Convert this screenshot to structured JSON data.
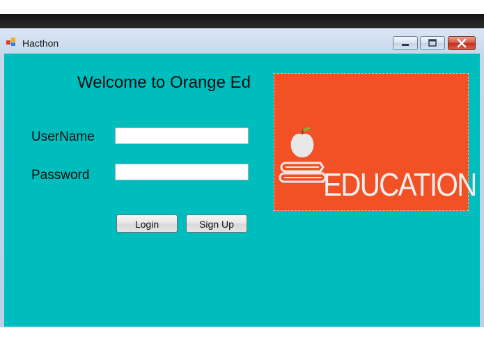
{
  "window": {
    "title": "Hacthon"
  },
  "form": {
    "welcome": "Welcome to Orange Ed",
    "username_label": "UserName",
    "password_label": "Password",
    "username_value": "",
    "password_value": "",
    "login_label": "Login",
    "signup_label": "Sign Up"
  },
  "picture": {
    "text": "EDUCATION",
    "icon": "apple-on-books-icon"
  },
  "colors": {
    "client_background": "#00bdbd",
    "picture_background": "#f25125"
  }
}
